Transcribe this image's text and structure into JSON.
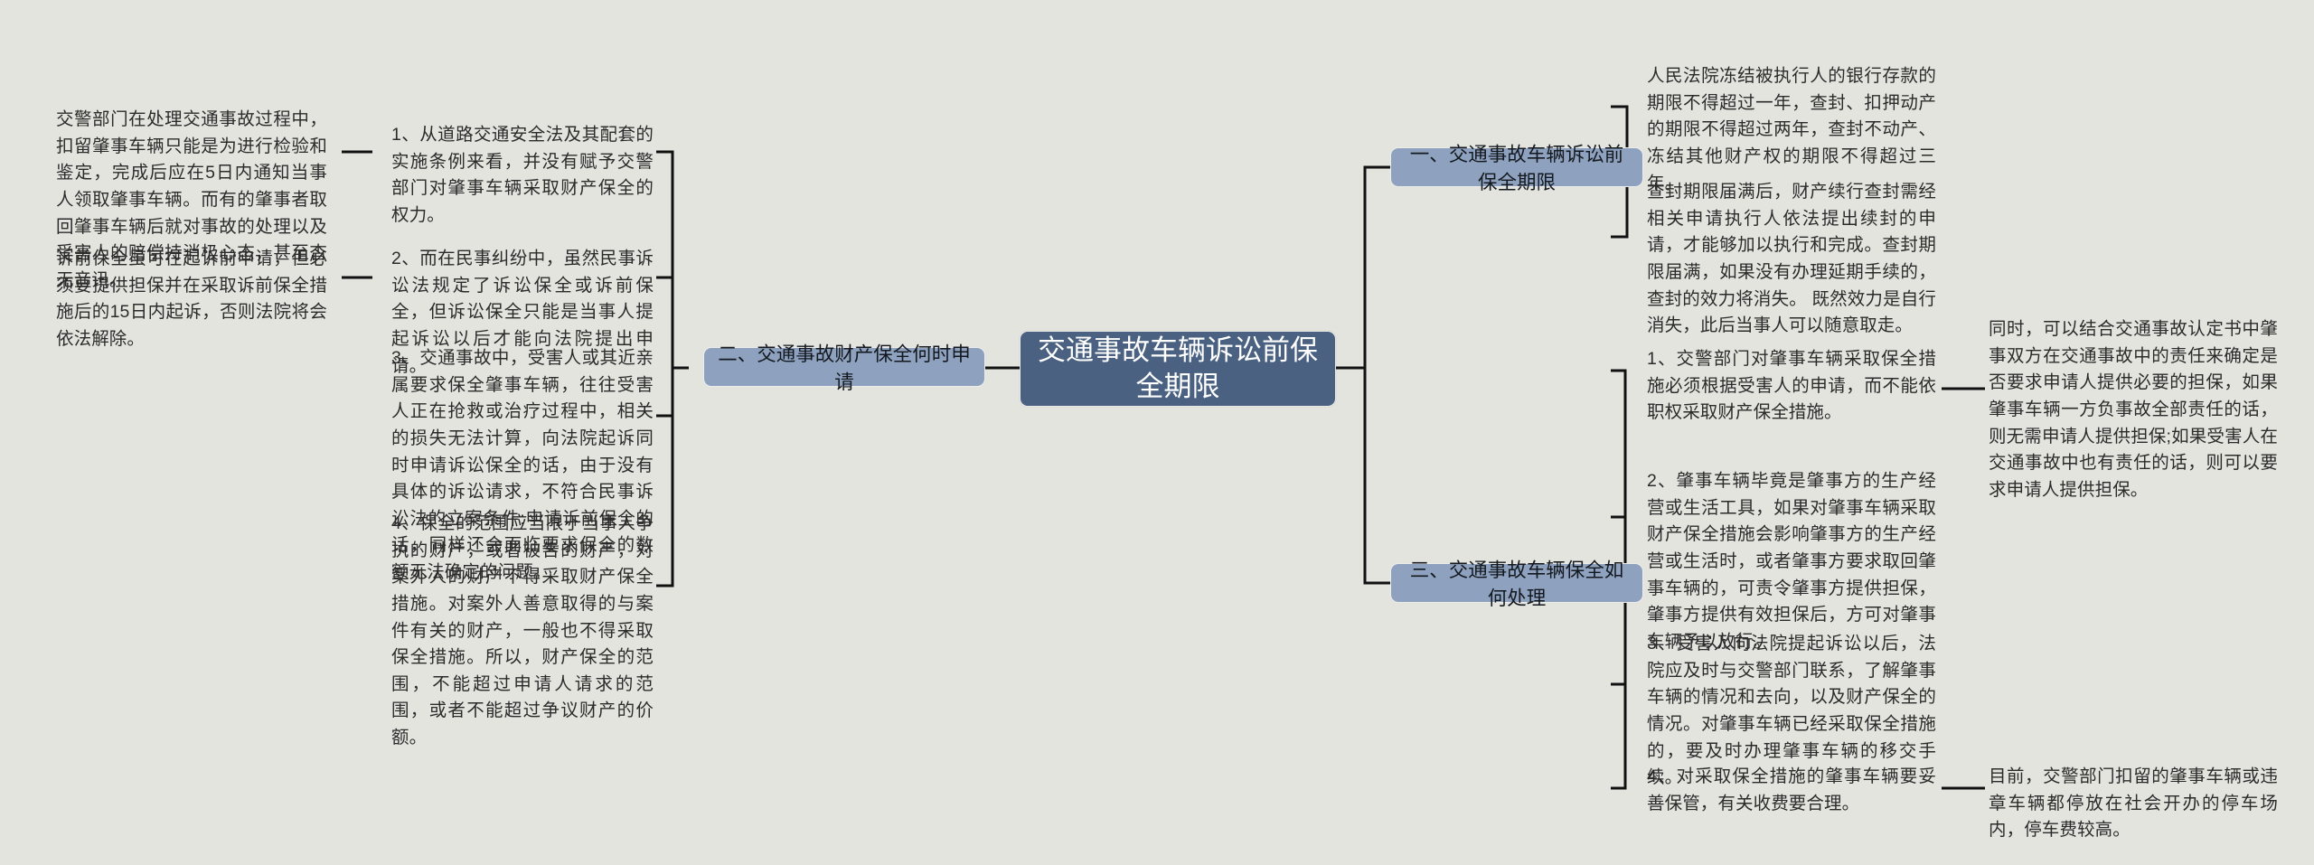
{
  "diagram": {
    "type": "mindmap",
    "background_color": "#e4e4df",
    "root_color": "#4a6181",
    "branch_color": "#8ea1be",
    "line_color": "#111111",
    "root": {
      "label": "交通事故车辆诉讼前保全期限"
    },
    "branches": [
      {
        "id": "branch-1",
        "label": "一、交通事故车辆诉讼前保全期限",
        "side": "right",
        "children": [
          {
            "id": "b1-c1",
            "text": "人民法院冻结被执行人的银行存款的期限不得超过一年，查封、扣押动产的期限不得超过两年，查封不动产、冻结其他财产权的期限不得超过三年。"
          },
          {
            "id": "b1-c2",
            "text": "查封期限届满后，财产续行查封需经相关申请执行人依法提出续封的申请，才能够加以执行和完成。查封期限届满，如果没有办理延期手续的，查封的效力将消失。 既然效力是自行消失，此后当事人可以随意取走。"
          }
        ]
      },
      {
        "id": "branch-2",
        "label": "二、交通事故财产保全何时申请",
        "side": "left",
        "children": [
          {
            "id": "b2-c1",
            "text": "1、从道路交通安全法及其配套的实施条例来看，并没有赋予交警部门对肇事车辆采取财产保全的权力。",
            "grandchildren": [
              {
                "id": "b2-c1-g1",
                "text": "交警部门在处理交通事故过程中，扣留肇事车辆只能是为进行检验和鉴定，完成后应在5日内通知当事人领取肇事车辆。而有的肇事者取回肇事车辆后就对事故的处理以及受害人的赔偿持消极心态，甚至杳无音讯。"
              }
            ]
          },
          {
            "id": "b2-c2",
            "text": "2、而在民事纠纷中，虽然民事诉讼法规定了诉讼保全或诉前保全，但诉讼保全只能是当事人提起诉讼以后才能向法院提出申请。",
            "grandchildren": [
              {
                "id": "b2-c2-g1",
                "text": "诉前保全虽可在起诉前申请，但必须要提供担保并在采取诉前保全措施后的15日内起诉，否则法院将会依法解除。"
              }
            ]
          },
          {
            "id": "b2-c3",
            "text": "3、交通事故中，受害人或其近亲属要求保全肇事车辆，往往受害人正在抢救或治疗过程中，相关的损失无法计算，向法院起诉同时申请诉讼保全的话，由于没有具体的诉讼请求，不符合民事诉讼法的立案条件;申请诉前保全的话，同样还会面临要求保全的数额无法确定的问题。"
          },
          {
            "id": "b2-c4",
            "text": "4、保全的范围应当限于当事人争执的财产，或者被告的财产，对案外人的财产不得采取财产保全措施。对案外人善意取得的与案件有关的财产，一般也不得采取保全措施。所以，财产保全的范围，不能超过申请人请求的范围，或者不能超过争议财产的价额。"
          }
        ]
      },
      {
        "id": "branch-3",
        "label": "三、交通事故车辆保全如何处理",
        "side": "right",
        "children": [
          {
            "id": "b3-c1",
            "text": "1、交警部门对肇事车辆采取保全措施必须根据受害人的申请，而不能依职权采取财产保全措施。",
            "grandchildren": [
              {
                "id": "b3-c1-g1",
                "text": "同时，可以结合交通事故认定书中肇事双方在交通事故中的责任来确定是否要求申请人提供必要的担保，如果肇事车辆一方负事故全部责任的话，则无需申请人提供担保;如果受害人在交通事故中也有责任的话，则可以要求申请人提供担保。"
              }
            ]
          },
          {
            "id": "b3-c2",
            "text": "2、肇事车辆毕竟是肇事方的生产经营或生活工具，如果对肇事车辆采取财产保全措施会影响肇事方的生产经营或生活时，或者肇事方要求取回肇事车辆的，可责令肇事方提供担保，肇事方提供有效担保后，方可对肇事车辆予以放行。"
          },
          {
            "id": "b3-c3",
            "text": "3、受害人向法院提起诉讼以后，法院应及时与交警部门联系，了解肇事车辆的情况和去向，以及财产保全的情况。对肇事车辆已经采取保全措施的，要及时办理肇事车辆的移交手续。"
          },
          {
            "id": "b3-c4",
            "text": "4、对采取保全措施的肇事车辆要妥善保管，有关收费要合理。",
            "grandchildren": [
              {
                "id": "b3-c4-g1",
                "text": "目前，交警部门扣留的肇事车辆或违章车辆都停放在社会开办的停车场内，停车费较高。"
              }
            ]
          }
        ]
      }
    ]
  }
}
